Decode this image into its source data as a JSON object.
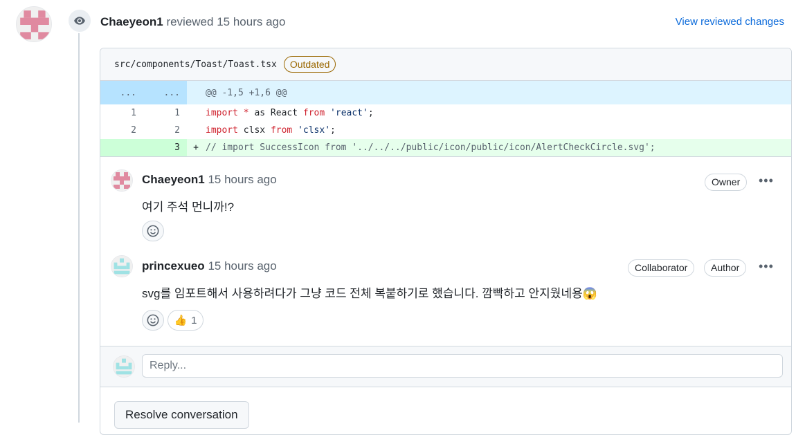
{
  "review": {
    "author": "Chaeyeon1",
    "action": "reviewed",
    "time": "15 hours ago",
    "view_changes_label": "View reviewed changes"
  },
  "file": {
    "path": "src/components/Toast/Toast.tsx",
    "status_badge": "Outdated"
  },
  "diff": {
    "hunk_left": "...",
    "hunk_right": "...",
    "hunk_header": "@@ -1,5 +1,6 @@",
    "lines": [
      {
        "old": "1",
        "new": "1",
        "marker": "",
        "kw1": "import",
        "mid1": " ",
        "op": "*",
        "mid2": " as React ",
        "kw2": "from",
        "sp": " ",
        "str": "'react'",
        "end": ";"
      },
      {
        "old": "2",
        "new": "2",
        "marker": "",
        "kw1": "import",
        "mid1": " clsx ",
        "kw2": "from",
        "sp": " ",
        "str": "'clsx'",
        "end": ";"
      },
      {
        "old": "",
        "new": "3",
        "marker": "+",
        "text": "// import SuccessIcon from '../../../public/icon/public/icon/AlertCheckCircle.svg';"
      }
    ]
  },
  "comments": [
    {
      "author": "Chaeyeon1",
      "time": "15 hours ago",
      "labels": [
        "Owner"
      ],
      "body": "여기 주석 먼니까!?"
    },
    {
      "author": "princexueo",
      "time": "15 hours ago",
      "labels": [
        "Collaborator",
        "Author"
      ],
      "body": "svg를 임포트해서 사용하려다가 그냥 코드 전체 복붙하기로 했습니다. 깜빡하고 안지웠네용😱",
      "reaction": {
        "emoji": "👍",
        "count": "1"
      }
    }
  ],
  "reply": {
    "placeholder": "Reply..."
  },
  "resolve_label": "Resolve conversation",
  "more_label": "•••",
  "icons": {
    "eye": "eye-icon",
    "smiley": "smiley-icon",
    "kebab": "kebab-horizontal-icon"
  }
}
